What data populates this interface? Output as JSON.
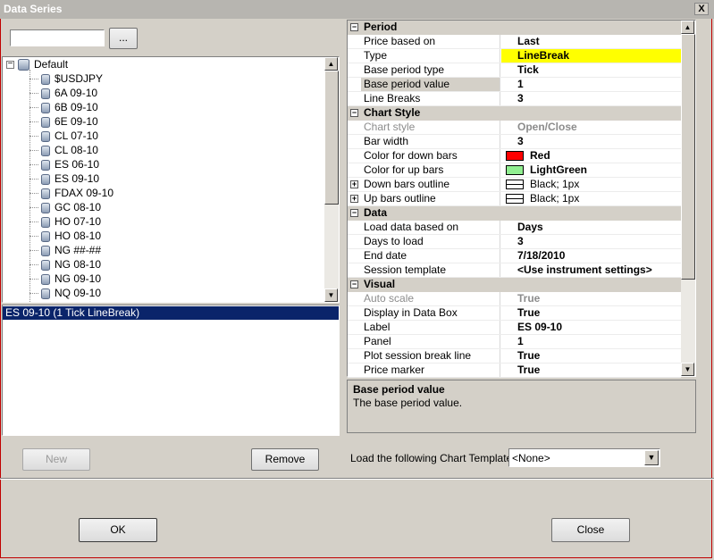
{
  "window": {
    "title": "Data Series",
    "close_glyph": "X"
  },
  "search": {
    "value": "",
    "browse_label": "..."
  },
  "tree": {
    "root_label": "Default",
    "root_expander": "−",
    "items": [
      "$USDJPY",
      "6A 09-10",
      "6B 09-10",
      "6E 09-10",
      "CL 07-10",
      "CL 08-10",
      "ES 06-10",
      "ES 09-10",
      "FDAX 09-10",
      "GC 08-10",
      "HO 07-10",
      "HO 08-10",
      "NG ##-##",
      "NG 08-10",
      "NG 09-10",
      "NQ 09-10"
    ]
  },
  "series_list": {
    "items": [
      "ES 09-10 (1 Tick LineBreak)"
    ]
  },
  "buttons": {
    "new": "New",
    "remove": "Remove",
    "ok": "OK",
    "close": "Close"
  },
  "properties": {
    "rows": [
      {
        "kind": "cat",
        "name": "Period",
        "expander": "−"
      },
      {
        "kind": "prop",
        "name": "Price based on",
        "value": "Last"
      },
      {
        "kind": "prop",
        "name": "Type",
        "value": "LineBreak",
        "highlight": "#ffff00"
      },
      {
        "kind": "prop",
        "name": "Base period type",
        "value": "Tick"
      },
      {
        "kind": "prop",
        "name": "Base period value",
        "value": "1",
        "selected": true
      },
      {
        "kind": "prop",
        "name": "Line Breaks",
        "value": "3"
      },
      {
        "kind": "cat",
        "name": "Chart Style",
        "expander": "−"
      },
      {
        "kind": "prop",
        "name": "Chart style",
        "value": "Open/Close",
        "disabled": true
      },
      {
        "kind": "prop",
        "name": "Bar width",
        "value": "3"
      },
      {
        "kind": "prop",
        "name": "Color for down bars",
        "value": "Red",
        "swatch": "#ff0000"
      },
      {
        "kind": "prop",
        "name": "Color for up bars",
        "value": "LightGreen",
        "swatch": "#90ee90"
      },
      {
        "kind": "prop",
        "name": "Down bars outline",
        "value": "Black; 1px",
        "expander": "+",
        "outline": true
      },
      {
        "kind": "prop",
        "name": "Up bars outline",
        "value": "Black; 1px",
        "expander": "+",
        "outline": true
      },
      {
        "kind": "cat",
        "name": "Data",
        "expander": "−"
      },
      {
        "kind": "prop",
        "name": "Load data based on",
        "value": "Days"
      },
      {
        "kind": "prop",
        "name": "Days to load",
        "value": "3"
      },
      {
        "kind": "prop",
        "name": "End date",
        "value": "7/18/2010"
      },
      {
        "kind": "prop",
        "name": "Session template",
        "value": "<Use instrument settings>"
      },
      {
        "kind": "cat",
        "name": "Visual",
        "expander": "−"
      },
      {
        "kind": "prop",
        "name": "Auto scale",
        "value": "True",
        "disabled": true
      },
      {
        "kind": "prop",
        "name": "Display in Data Box",
        "value": "True"
      },
      {
        "kind": "prop",
        "name": "Label",
        "value": "ES 09-10"
      },
      {
        "kind": "prop",
        "name": "Panel",
        "value": "1"
      },
      {
        "kind": "prop",
        "name": "Plot session break line",
        "value": "True"
      },
      {
        "kind": "prop",
        "name": "Price marker",
        "value": "True"
      }
    ]
  },
  "description": {
    "title": "Base period value",
    "text": "The base period value."
  },
  "template": {
    "label": "Load the following Chart Template:",
    "value": "<None>"
  },
  "colors": {
    "selection": "#0a246a",
    "highlight": "#ffff00",
    "frame": "#c00000"
  }
}
